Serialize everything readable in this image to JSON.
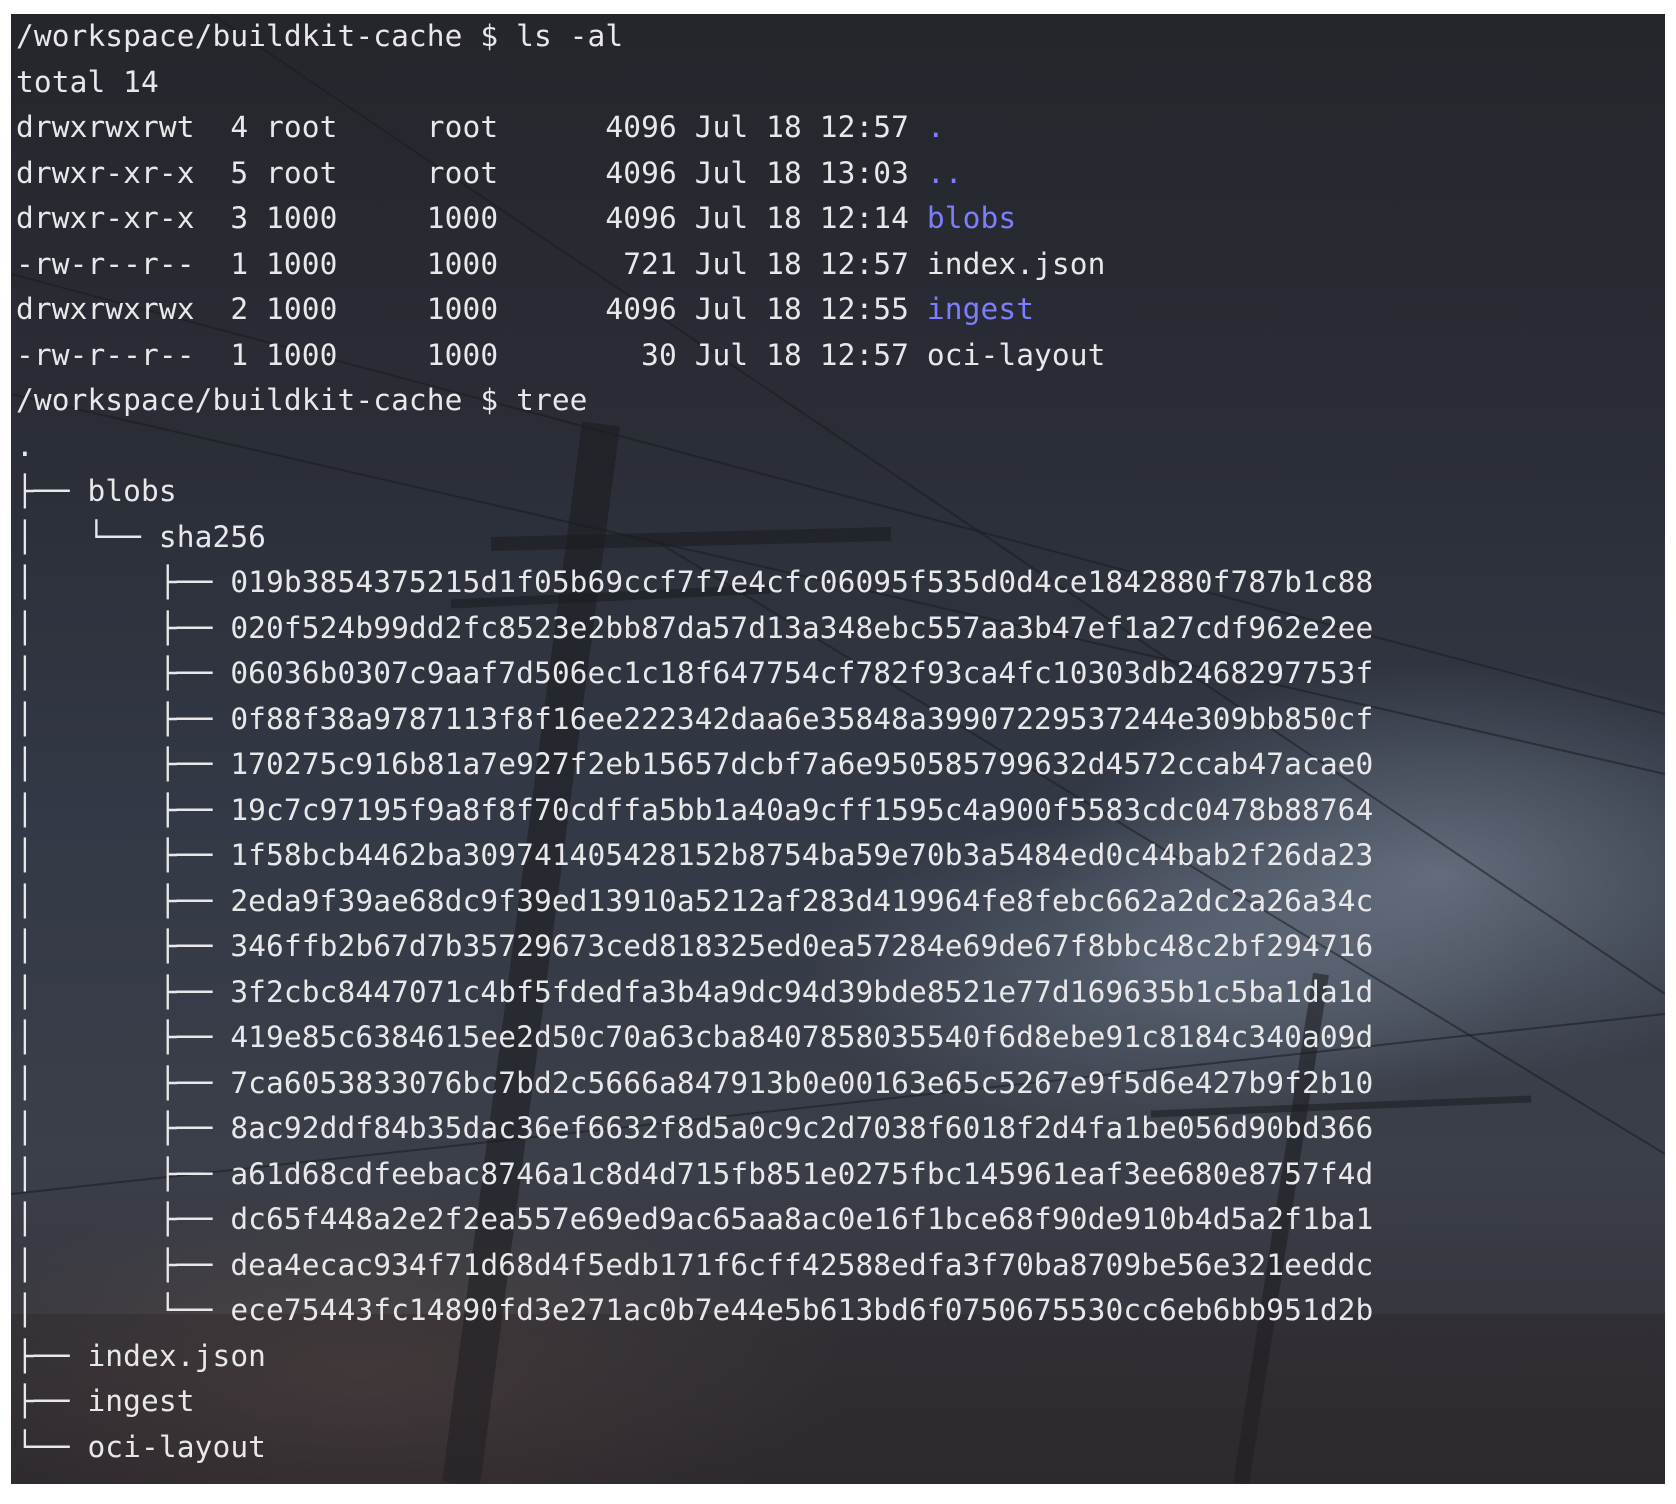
{
  "colors": {
    "text": "#e8e8ea",
    "directory": "#7d7dff"
  },
  "session": [
    {
      "prompt": "/workspace/buildkit-cache $",
      "command": "ls -al"
    }
  ],
  "ls": {
    "total": "total 14",
    "rows": [
      {
        "perms": "drwxrwxrwt",
        "links": "4",
        "owner": "root",
        "group": "root",
        "size": "4096",
        "date": "Jul 18 12:57",
        "name": ".",
        "is_dir": true
      },
      {
        "perms": "drwxr-xr-x",
        "links": "5",
        "owner": "root",
        "group": "root",
        "size": "4096",
        "date": "Jul 18 13:03",
        "name": "..",
        "is_dir": true
      },
      {
        "perms": "drwxr-xr-x",
        "links": "3",
        "owner": "1000",
        "group": "1000",
        "size": "4096",
        "date": "Jul 18 12:14",
        "name": "blobs",
        "is_dir": true
      },
      {
        "perms": "-rw-r--r--",
        "links": "1",
        "owner": "1000",
        "group": "1000",
        "size": "721",
        "date": "Jul 18 12:57",
        "name": "index.json",
        "is_dir": false
      },
      {
        "perms": "drwxrwxrwx",
        "links": "2",
        "owner": "1000",
        "group": "1000",
        "size": "4096",
        "date": "Jul 18 12:55",
        "name": "ingest",
        "is_dir": true
      },
      {
        "perms": "-rw-r--r--",
        "links": "1",
        "owner": "1000",
        "group": "1000",
        "size": "30",
        "date": "Jul 18 12:57",
        "name": "oci-layout",
        "is_dir": false
      }
    ]
  },
  "tree_command": {
    "prompt": "/workspace/buildkit-cache $",
    "command": "tree"
  },
  "tree": {
    "root": ".",
    "blobs": "blobs",
    "sha256": "sha256",
    "hashes": [
      "019b3854375215d1f05b69ccf7f7e4cfc06095f535d0d4ce1842880f787b1c88",
      "020f524b99dd2fc8523e2bb87da57d13a348ebc557aa3b47ef1a27cdf962e2ee",
      "06036b0307c9aaf7d506ec1c18f647754cf782f93ca4fc10303db2468297753f",
      "0f88f38a9787113f8f16ee222342daa6e35848a39907229537244e309bb850cf",
      "170275c916b81a7e927f2eb15657dcbf7a6e950585799632d4572ccab47acae0",
      "19c7c97195f9a8f8f70cdffa5bb1a40a9cff1595c4a900f5583cdc0478b88764",
      "1f58bcb4462ba309741405428152b8754ba59e70b3a5484ed0c44bab2f26da23",
      "2eda9f39ae68dc9f39ed13910a5212af283d419964fe8febc662a2dc2a26a34c",
      "346ffb2b67d7b35729673ced818325ed0ea57284e69de67f8bbc48c2bf294716",
      "3f2cbc8447071c4bf5fdedfa3b4a9dc94d39bde8521e77d169635b1c5ba1da1d",
      "419e85c6384615ee2d50c70a63cba8407858035540f6d8ebe91c8184c340a09d",
      "7ca6053833076bc7bd2c5666a847913b0e00163e65c5267e9f5d6e427b9f2b10",
      "8ac92ddf84b35dac36ef6632f8d5a0c9c2d7038f6018f2d4fa1be056d90bd366",
      "a61d68cdfeebac8746a1c8d4d715fb851e0275fbc145961eaf3ee680e8757f4d",
      "dc65f448a2e2f2ea557e69ed9ac65aa8ac0e16f1bce68f90de910b4d5a2f1ba1",
      "dea4ecac934f71d68d4f5edb171f6cff42588edfa3f70ba8709be56e321eeddc",
      "ece75443fc14890fd3e271ac0b7e44e5b613bd6f0750675530cc6eb6bb951d2b"
    ],
    "files": [
      "index.json",
      "ingest",
      "oci-layout"
    ]
  }
}
